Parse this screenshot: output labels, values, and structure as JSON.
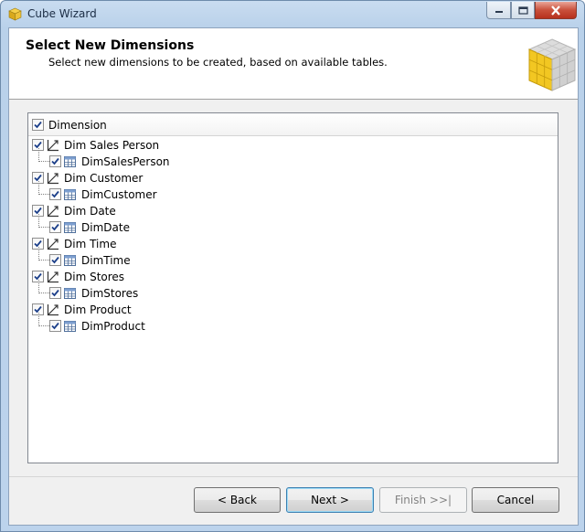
{
  "window": {
    "title": "Cube Wizard"
  },
  "header": {
    "title": "Select New Dimensions",
    "subtitle": "Select new dimensions to be created, based on available tables."
  },
  "tree": {
    "column_header": "Dimension",
    "header_checked": true,
    "dimensions": [
      {
        "label": "Dim Sales Person",
        "checked": true,
        "tables": [
          {
            "label": "DimSalesPerson",
            "checked": true
          }
        ]
      },
      {
        "label": "Dim Customer",
        "checked": true,
        "tables": [
          {
            "label": "DimCustomer",
            "checked": true
          }
        ]
      },
      {
        "label": "Dim Date",
        "checked": true,
        "tables": [
          {
            "label": "DimDate",
            "checked": true
          }
        ]
      },
      {
        "label": "Dim Time",
        "checked": true,
        "tables": [
          {
            "label": "DimTime",
            "checked": true
          }
        ]
      },
      {
        "label": "Dim Stores",
        "checked": true,
        "tables": [
          {
            "label": "DimStores",
            "checked": true
          }
        ]
      },
      {
        "label": "Dim Product",
        "checked": true,
        "tables": [
          {
            "label": "DimProduct",
            "checked": true
          }
        ]
      }
    ]
  },
  "buttons": {
    "back": "< Back",
    "next": "Next >",
    "finish": "Finish >>|",
    "cancel": "Cancel"
  },
  "icons": {
    "app": "cube-icon",
    "dimension": "dimension-icon",
    "table": "table-icon",
    "banner": "cube-banner-icon"
  }
}
